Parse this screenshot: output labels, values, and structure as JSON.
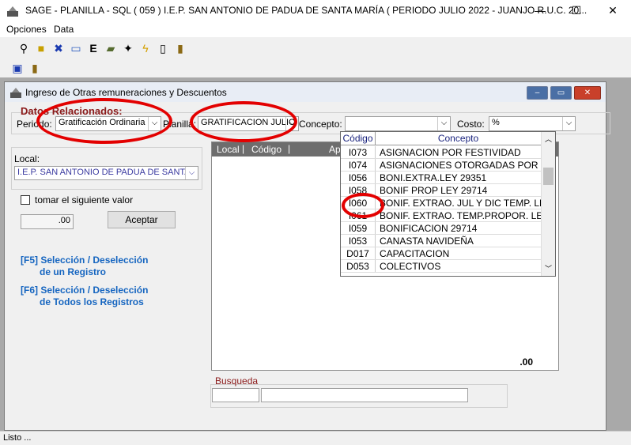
{
  "window": {
    "title": "SAGE - PLANILLA - SQL  ( 059 ) I.E.P. SAN ANTONIO DE PADUA DE SANTA MARÍA ( PERIODO JULIO 2022 - JUANJO  R.U.C. 20...",
    "min": "—",
    "max": "☐",
    "close": "✕"
  },
  "menu": {
    "items": [
      "Opciones",
      "Data"
    ]
  },
  "child": {
    "title": "Ingreso de Otras remuneraciones y Descuentos",
    "min": "–",
    "max": "▭",
    "close": "✕"
  },
  "form": {
    "group_label": "Datos Relacionados:",
    "periodo_label": "Periodo:",
    "periodo_value": "Gratificación Ordinaria",
    "planilla_label": "Planilla:",
    "planilla_value": "GRATIFICACION JULIO",
    "concepto_label": "Concepto:",
    "concepto_value": "",
    "costo_label": "Costo:",
    "costo_value": "%",
    "local_label": "Local:",
    "local_value": "I.E.P. SAN ANTONIO DE PADUA DE SANTA",
    "checkbox_label": "tomar el siguiente valor",
    "amount_value": ".00",
    "accept_label": "Aceptar",
    "f5_line1": "[F5] Selección / Deselección",
    "f5_line2": "de un Registro",
    "f6_line1": "[F6] Selección / Deselección",
    "f6_line2": "de Todos los Registros",
    "total_value": ".00",
    "busqueda_label": "Busqueda"
  },
  "grid": {
    "columns": [
      "Local",
      "Código",
      "Ape"
    ]
  },
  "dropdown": {
    "col_code": "Código",
    "col_desc": "Concepto",
    "rows": [
      {
        "code": "I073",
        "desc": "ASIGNACION POR FESTIVIDAD"
      },
      {
        "code": "I074",
        "desc": "ASIGNACIONES OTORGADAS POR CO"
      },
      {
        "code": "I056",
        "desc": "BONI.EXTRA.LEY 29351"
      },
      {
        "code": "I058",
        "desc": "BONIF PROP LEY 29714"
      },
      {
        "code": "I060",
        "desc": "BONIF. EXTRAO. JUL Y DIC TEMP. LE"
      },
      {
        "code": "I061",
        "desc": "BONIF. EXTRAO. TEMP.PROPOR.  LEY"
      },
      {
        "code": "I059",
        "desc": "BONIFICACION 29714"
      },
      {
        "code": "I053",
        "desc": "CANASTA NAVIDEÑA"
      },
      {
        "code": "D017",
        "desc": "CAPACITACION"
      },
      {
        "code": "D053",
        "desc": "COLECTIVOS"
      }
    ]
  },
  "status": {
    "text": "Listo ..."
  },
  "icons": [
    "app-icon",
    "toolbar-icons",
    "save-icon",
    "exit-icon"
  ],
  "colors": {
    "highlight": "#e30000",
    "link": "#1565c0",
    "group_label": "#8b1a1a"
  }
}
